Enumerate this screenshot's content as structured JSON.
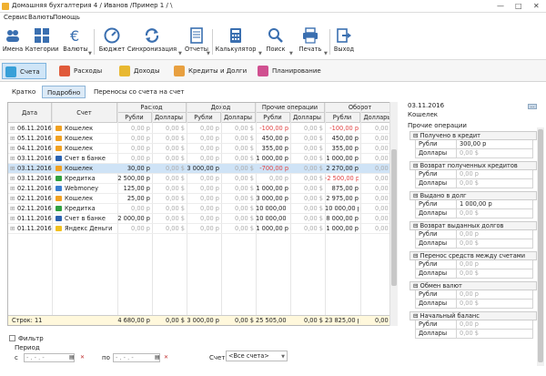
{
  "window": {
    "title": "Домашняя бухгалтерия 4 / Иванов /Пример 1 / \\"
  },
  "menu": [
    "Сервис",
    "Валюты",
    "Помощь"
  ],
  "toolbar": [
    {
      "label": "Имена",
      "icon": "users-icon",
      "color": "#3a6fb0"
    },
    {
      "label": "Категории",
      "icon": "categories-icon",
      "color": "#3a6fb0"
    },
    {
      "label": "Валюты",
      "icon": "euro-icon",
      "color": "#3a6fb0"
    },
    {
      "label": "Бюджет",
      "icon": "budget-icon",
      "color": "#3a6fb0"
    },
    {
      "label": "Синхронизация",
      "icon": "sync-icon",
      "color": "#3a6fb0"
    },
    {
      "label": "Отчеты",
      "icon": "reports-icon",
      "color": "#3a6fb0"
    },
    {
      "label": "Калькулятор",
      "icon": "calculator-icon",
      "color": "#3a6fb0"
    },
    {
      "label": "Поиск",
      "icon": "search-icon",
      "color": "#3a6fb0"
    },
    {
      "label": "Печать",
      "icon": "print-icon",
      "color": "#3a6fb0"
    },
    {
      "label": "Выход",
      "icon": "exit-icon",
      "color": "#3a6fb0"
    }
  ],
  "section_tabs": [
    {
      "label": "Счета",
      "color": "#38a0d8",
      "active": true
    },
    {
      "label": "Расходы",
      "color": "#e05a3a",
      "active": false
    },
    {
      "label": "Доходы",
      "color": "#e8b830",
      "active": false
    },
    {
      "label": "Кредиты и Долги",
      "color": "#e8a040",
      "active": false
    },
    {
      "label": "Планирование",
      "color": "#d05090",
      "active": false
    }
  ],
  "view_tabs": [
    {
      "label": "Кратко",
      "active": false
    },
    {
      "label": "Подробно",
      "active": true
    },
    {
      "label": "Переносы со счета на счет",
      "active": false
    }
  ],
  "grid": {
    "headers": {
      "date": "Дата",
      "account": "Счет",
      "expense": "Расход",
      "income": "Доход",
      "other": "Прочие операции",
      "turnover": "Оборот",
      "rub": "Рубли",
      "usd": "Доллары"
    },
    "rows": [
      {
        "date": "06.11.2016",
        "account": "Кошелек",
        "icon": "wallet",
        "exp_r": "0,00 р",
        "exp_d": "0,00 $",
        "inc_r": "0,00 р",
        "inc_d": "0,00 $",
        "oth_r": "-100,00 р",
        "oth_d": "0,00 $",
        "tur_r": "-100,00 р",
        "tur_d": "0,00 $"
      },
      {
        "date": "05.11.2016",
        "account": "Кошелек",
        "icon": "wallet",
        "exp_r": "0,00 р",
        "exp_d": "0,00 $",
        "inc_r": "0,00 р",
        "inc_d": "0,00 $",
        "oth_r": "450,00 р",
        "oth_d": "0,00 $",
        "tur_r": "450,00 р",
        "tur_d": "0,00 $"
      },
      {
        "date": "04.11.2016",
        "account": "Кошелек",
        "icon": "wallet",
        "exp_r": "0,00 р",
        "exp_d": "0,00 $",
        "inc_r": "0,00 р",
        "inc_d": "0,00 $",
        "oth_r": "355,00 р",
        "oth_d": "0,00 $",
        "tur_r": "355,00 р",
        "tur_d": "0,00 $"
      },
      {
        "date": "03.11.2016",
        "account": "Счет в банке",
        "icon": "visa",
        "exp_r": "0,00 р",
        "exp_d": "0,00 $",
        "inc_r": "0,00 р",
        "inc_d": "0,00 $",
        "oth_r": "1 000,00 р",
        "oth_d": "0,00 $",
        "tur_r": "1 000,00 р",
        "tur_d": "0,00 $"
      },
      {
        "date": "03.11.2016",
        "account": "Кошелек",
        "icon": "wallet",
        "exp_r": "30,00 р",
        "exp_d": "0,00 $",
        "inc_r": "3 000,00 р",
        "inc_d": "0,00 $",
        "oth_r": "-700,00 р",
        "oth_d": "0,00 $",
        "tur_r": "2 270,00 р",
        "tur_d": "0,00 $",
        "selected": true
      },
      {
        "date": "03.11.2016",
        "account": "Кредитка",
        "icon": "card",
        "exp_r": "2 500,00 р",
        "exp_d": "0,00 $",
        "inc_r": "0,00 р",
        "inc_d": "0,00 $",
        "oth_r": "0,00 р",
        "oth_d": "0,00 $",
        "tur_r": "-2 500,00 р",
        "tur_d": "0,00 $"
      },
      {
        "date": "02.11.2016",
        "account": "Webmoney",
        "icon": "webmoney",
        "exp_r": "125,00 р",
        "exp_d": "0,00 $",
        "inc_r": "0,00 р",
        "inc_d": "0,00 $",
        "oth_r": "1 000,00 р",
        "oth_d": "0,00 $",
        "tur_r": "875,00 р",
        "tur_d": "0,00 $"
      },
      {
        "date": "02.11.2016",
        "account": "Кошелек",
        "icon": "wallet",
        "exp_r": "25,00 р",
        "exp_d": "0,00 $",
        "inc_r": "0,00 р",
        "inc_d": "0,00 $",
        "oth_r": "3 000,00 р",
        "oth_d": "0,00 $",
        "tur_r": "2 975,00 р",
        "tur_d": "0,00 $"
      },
      {
        "date": "02.11.2016",
        "account": "Кредитка",
        "icon": "card",
        "exp_r": "0,00 р",
        "exp_d": "0,00 $",
        "inc_r": "0,00 р",
        "inc_d": "0,00 $",
        "oth_r": "10 000,00 р",
        "oth_d": "0,00 $",
        "tur_r": "10 000,00 р",
        "tur_d": "0,00 $"
      },
      {
        "date": "01.11.2016",
        "account": "Счет в банке",
        "icon": "visa",
        "exp_r": "2 000,00 р",
        "exp_d": "0,00 $",
        "inc_r": "0,00 р",
        "inc_d": "0,00 $",
        "oth_r": "10 000,00 р",
        "oth_d": "0,00 $",
        "tur_r": "8 000,00 р",
        "tur_d": "0,00 $"
      },
      {
        "date": "01.11.2016",
        "account": "Яндекс Деньги",
        "icon": "yandex",
        "exp_r": "0,00 р",
        "exp_d": "0,00 $",
        "inc_r": "0,00 р",
        "inc_d": "0,00 $",
        "oth_r": "1 000,00 р",
        "oth_d": "0,00 $",
        "tur_r": "1 000,00 р",
        "tur_d": "0,00 $"
      }
    ],
    "totals": {
      "label": "Строк: 11",
      "exp_r": "4 680,00 р",
      "exp_d": "0,00 $",
      "inc_r": "3 000,00 р",
      "inc_d": "0,00 $",
      "oth_r": "25 505,00 р",
      "oth_d": "0,00 $",
      "tur_r": "23 825,00 р",
      "tur_d": "0,00 $"
    }
  },
  "filter": {
    "label": "Фильтр",
    "period": "Период",
    "from": "с",
    "to": "по",
    "date_placeholder": "- . - . -",
    "account_label": "Счет",
    "account_value": "<Все счета>"
  },
  "details": {
    "date": "03.11.2016",
    "account": "Кошелек",
    "section": "Прочие операции",
    "groups": [
      {
        "title": "Получено в кредит",
        "rub": "300,00 р",
        "usd": "0,00 $"
      },
      {
        "title": "Возврат полученных кредитов",
        "rub": "0,00 р",
        "usd": "0,00 $"
      },
      {
        "title": "Выдано в долг",
        "rub": "1 000,00 р",
        "usd": "0,00 $"
      },
      {
        "title": "Возврат выданных долгов",
        "rub": "0,00 р",
        "usd": "0,00 $"
      },
      {
        "title": "Перенос средств между счетами",
        "rub": "0,00 р",
        "usd": "0,00 $"
      },
      {
        "title": "Обмен валют",
        "rub": "0,00 р",
        "usd": "0,00 $"
      },
      {
        "title": "Начальный баланс",
        "rub": "0,00 р",
        "usd": "0,00 $"
      }
    ],
    "rub_label": "Рубли",
    "usd_label": "Доллары"
  }
}
